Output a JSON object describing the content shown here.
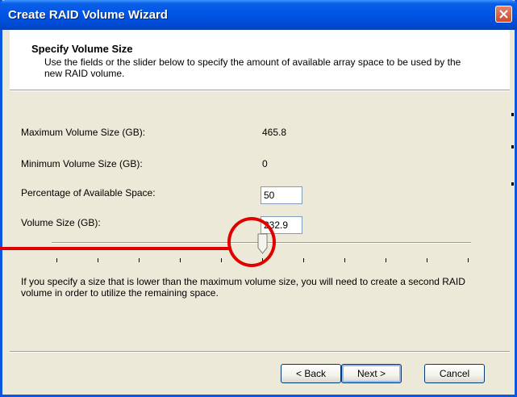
{
  "window": {
    "title": "Create RAID Volume Wizard"
  },
  "header": {
    "title": "Specify Volume Size",
    "description": "Use the fields or the slider below to specify the amount of available array space to be used by the new RAID volume."
  },
  "fields": {
    "max_label": "Maximum Volume Size (GB):",
    "max_value": "465.8",
    "min_label": "Minimum Volume Size (GB):",
    "min_value": "0",
    "pct_label": "Percentage of Available Space:",
    "pct_value": "50",
    "size_label": "Volume Size (GB):",
    "size_value": "232.9"
  },
  "slider": {
    "min": 0,
    "max": 100,
    "value": 50,
    "tick_count": 11
  },
  "note": "If you specify a size that is lower than the maximum volume size, you will need to create a second RAID volume in order to utilize the remaining space.",
  "buttons": {
    "back": "< Back",
    "next": "Next >",
    "cancel": "Cancel"
  },
  "colors": {
    "title_bar": "#0054E3",
    "annotation": "#E10000",
    "dialog_bg": "#ECE9D8"
  },
  "icons": {
    "close": "close-icon",
    "thumb": "slider-thumb"
  }
}
